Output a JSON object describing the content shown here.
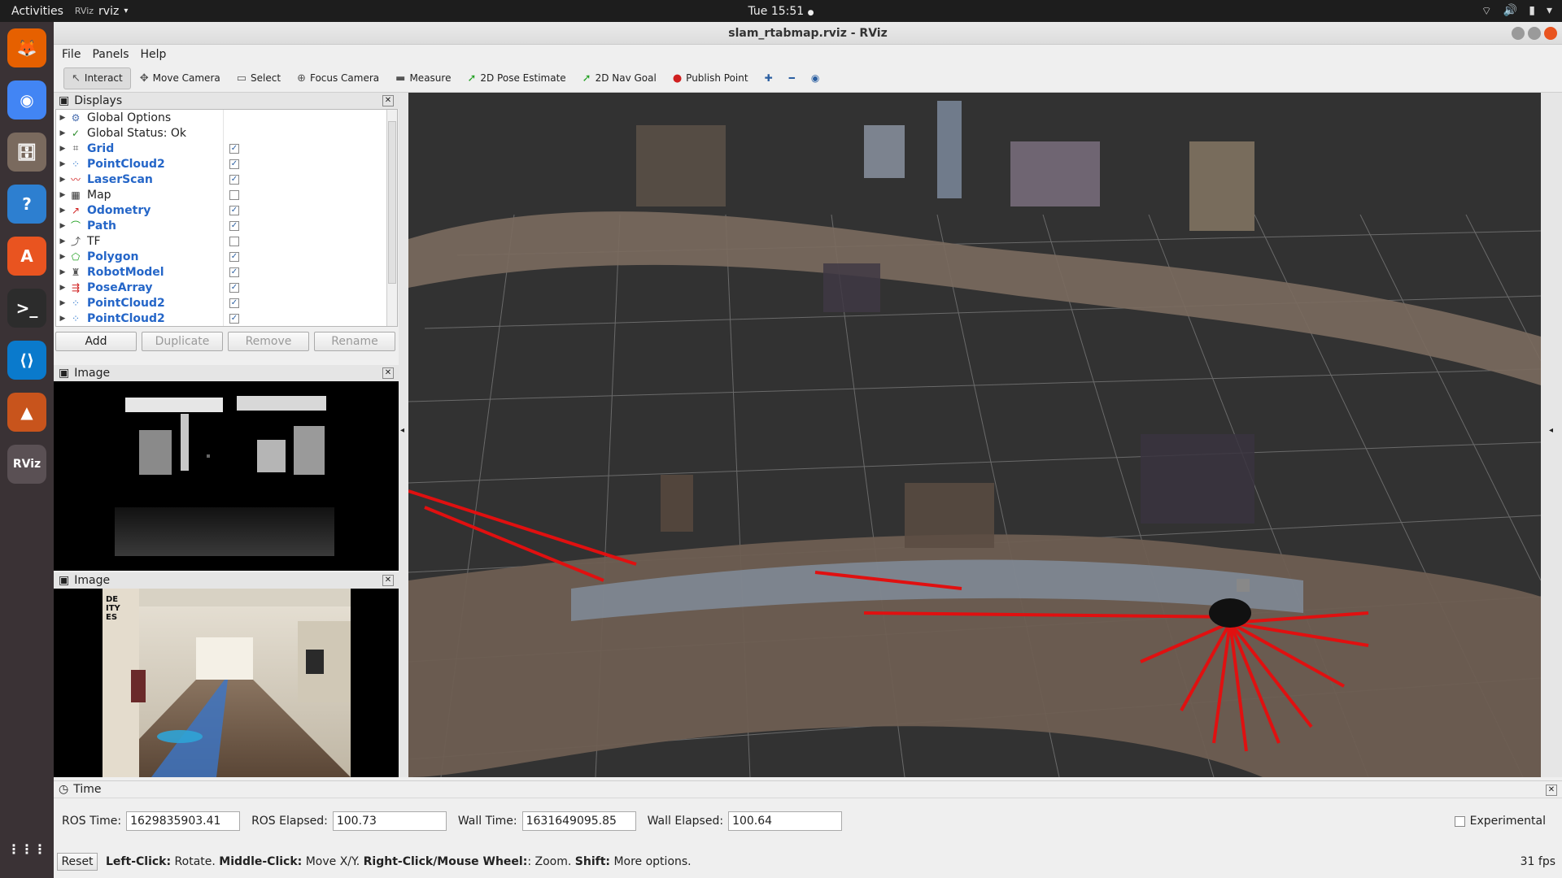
{
  "topbar": {
    "activities": "Activities",
    "app_name": "rviz",
    "app_badge": "RViz",
    "clock": "Tue 15:51"
  },
  "dock": {
    "items": [
      {
        "name": "firefox-icon",
        "glyph": "🦊"
      },
      {
        "name": "chrome-icon",
        "glyph": "◉"
      },
      {
        "name": "files-icon",
        "glyph": "🗄"
      },
      {
        "name": "help-icon",
        "glyph": "?"
      },
      {
        "name": "software-center-icon",
        "glyph": "A"
      },
      {
        "name": "terminal-icon",
        "glyph": ">_"
      },
      {
        "name": "vscode-icon",
        "glyph": "⟨⟩"
      },
      {
        "name": "matlab-icon",
        "glyph": "▲"
      },
      {
        "name": "rviz-icon",
        "glyph": "RViz"
      }
    ]
  },
  "window": {
    "title": "slam_rtabmap.rviz - RViz",
    "menu": [
      "File",
      "Panels",
      "Help"
    ]
  },
  "toolbar": {
    "tools": [
      {
        "label": "Interact",
        "icon": "↖",
        "active": true
      },
      {
        "label": "Move Camera",
        "icon": "✥"
      },
      {
        "label": "Select",
        "icon": "▭"
      },
      {
        "label": "Focus Camera",
        "icon": "⊕"
      },
      {
        "label": "Measure",
        "icon": "▬"
      },
      {
        "label": "2D Pose Estimate",
        "icon": "➚"
      },
      {
        "label": "2D Nav Goal",
        "icon": "➚"
      },
      {
        "label": "Publish Point",
        "icon": "●"
      }
    ]
  },
  "displays": {
    "title": "Displays",
    "items": [
      {
        "label": "Global Options",
        "icon": "⚙",
        "color": "#4a6fb0",
        "enabled": false,
        "checkbox": null
      },
      {
        "label": "Global Status: Ok",
        "icon": "✓",
        "color": "#2a8a2a",
        "enabled": false,
        "checkbox": null
      },
      {
        "label": "Grid",
        "icon": "⌗",
        "color": "#555",
        "enabled": true,
        "checkbox": true
      },
      {
        "label": "PointCloud2",
        "icon": "⁘",
        "color": "#3a7fd0",
        "enabled": true,
        "checkbox": true
      },
      {
        "label": "LaserScan",
        "icon": "〰",
        "color": "#d02020",
        "enabled": true,
        "checkbox": true
      },
      {
        "label": "Map",
        "icon": "▦",
        "color": "#333",
        "enabled": false,
        "checkbox": false
      },
      {
        "label": "Odometry",
        "icon": "↗",
        "color": "#d02020",
        "enabled": true,
        "checkbox": true
      },
      {
        "label": "Path",
        "icon": "⌒",
        "color": "#20a020",
        "enabled": true,
        "checkbox": true
      },
      {
        "label": "TF",
        "icon": "⤴",
        "color": "#555",
        "enabled": false,
        "checkbox": false
      },
      {
        "label": "Polygon",
        "icon": "⬠",
        "color": "#20a020",
        "enabled": true,
        "checkbox": true
      },
      {
        "label": "RobotModel",
        "icon": "♜",
        "color": "#555",
        "enabled": true,
        "checkbox": true
      },
      {
        "label": "PoseArray",
        "icon": "⇶",
        "color": "#d02020",
        "enabled": true,
        "checkbox": true
      },
      {
        "label": "PointCloud2",
        "icon": "⁘",
        "color": "#3a7fd0",
        "enabled": true,
        "checkbox": true
      },
      {
        "label": "PointCloud2",
        "icon": "⁘",
        "color": "#3a7fd0",
        "enabled": true,
        "checkbox": true
      }
    ],
    "buttons": {
      "add": "Add",
      "duplicate": "Duplicate",
      "remove": "Remove",
      "rename": "Rename"
    }
  },
  "image_panels": {
    "depth_title": "Image",
    "rgb_title": "Image",
    "rgb_sign_text": "DE\nITY\nES"
  },
  "time": {
    "title": "Time",
    "ros_time_label": "ROS Time:",
    "ros_time": "1629835903.41",
    "ros_elapsed_label": "ROS Elapsed:",
    "ros_elapsed": "100.73",
    "wall_time_label": "Wall Time:",
    "wall_time": "1631649095.85",
    "wall_elapsed_label": "Wall Elapsed:",
    "wall_elapsed": "100.64",
    "experimental": "Experimental"
  },
  "status": {
    "reset": "Reset",
    "left_click_b": "Left-Click:",
    "left_click": "Rotate.",
    "middle_click_b": "Middle-Click:",
    "middle_click": "Move X/Y.",
    "right_click_b": "Right-Click/Mouse Wheel:",
    "right_click": ": Zoom.",
    "shift_b": "Shift:",
    "shift": "More options.",
    "fps": "31 fps"
  }
}
